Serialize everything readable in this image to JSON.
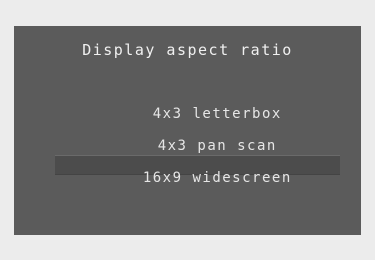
{
  "menu": {
    "title": "Display aspect ratio",
    "options": [
      {
        "label": "4x3 letterbox",
        "selected": false
      },
      {
        "label": "4x3 pan scan",
        "selected": false
      },
      {
        "label": "16x9 widescreen",
        "selected": true
      }
    ]
  },
  "colors": {
    "background": "#ececec",
    "panel": "#5b5b5b",
    "highlight": "#4c4c4c",
    "text": "#f0f0f0"
  }
}
